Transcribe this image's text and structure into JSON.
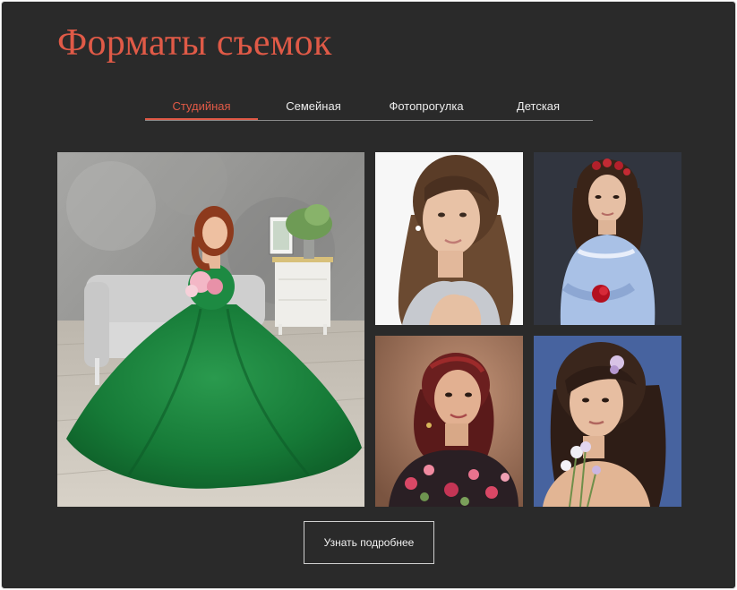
{
  "section": {
    "title": "Форматы съемок",
    "tabs": [
      {
        "label": "Студийная",
        "active": true
      },
      {
        "label": "Семейная",
        "active": false
      },
      {
        "label": "Фотопрогулка",
        "active": false
      },
      {
        "label": "Детская",
        "active": false
      }
    ],
    "cta_label": "Узнать подробнее"
  },
  "colors": {
    "background": "#2a2a2a",
    "accent": "#e05a47",
    "text": "#ececec",
    "tab_track": "#8a8a8a"
  }
}
